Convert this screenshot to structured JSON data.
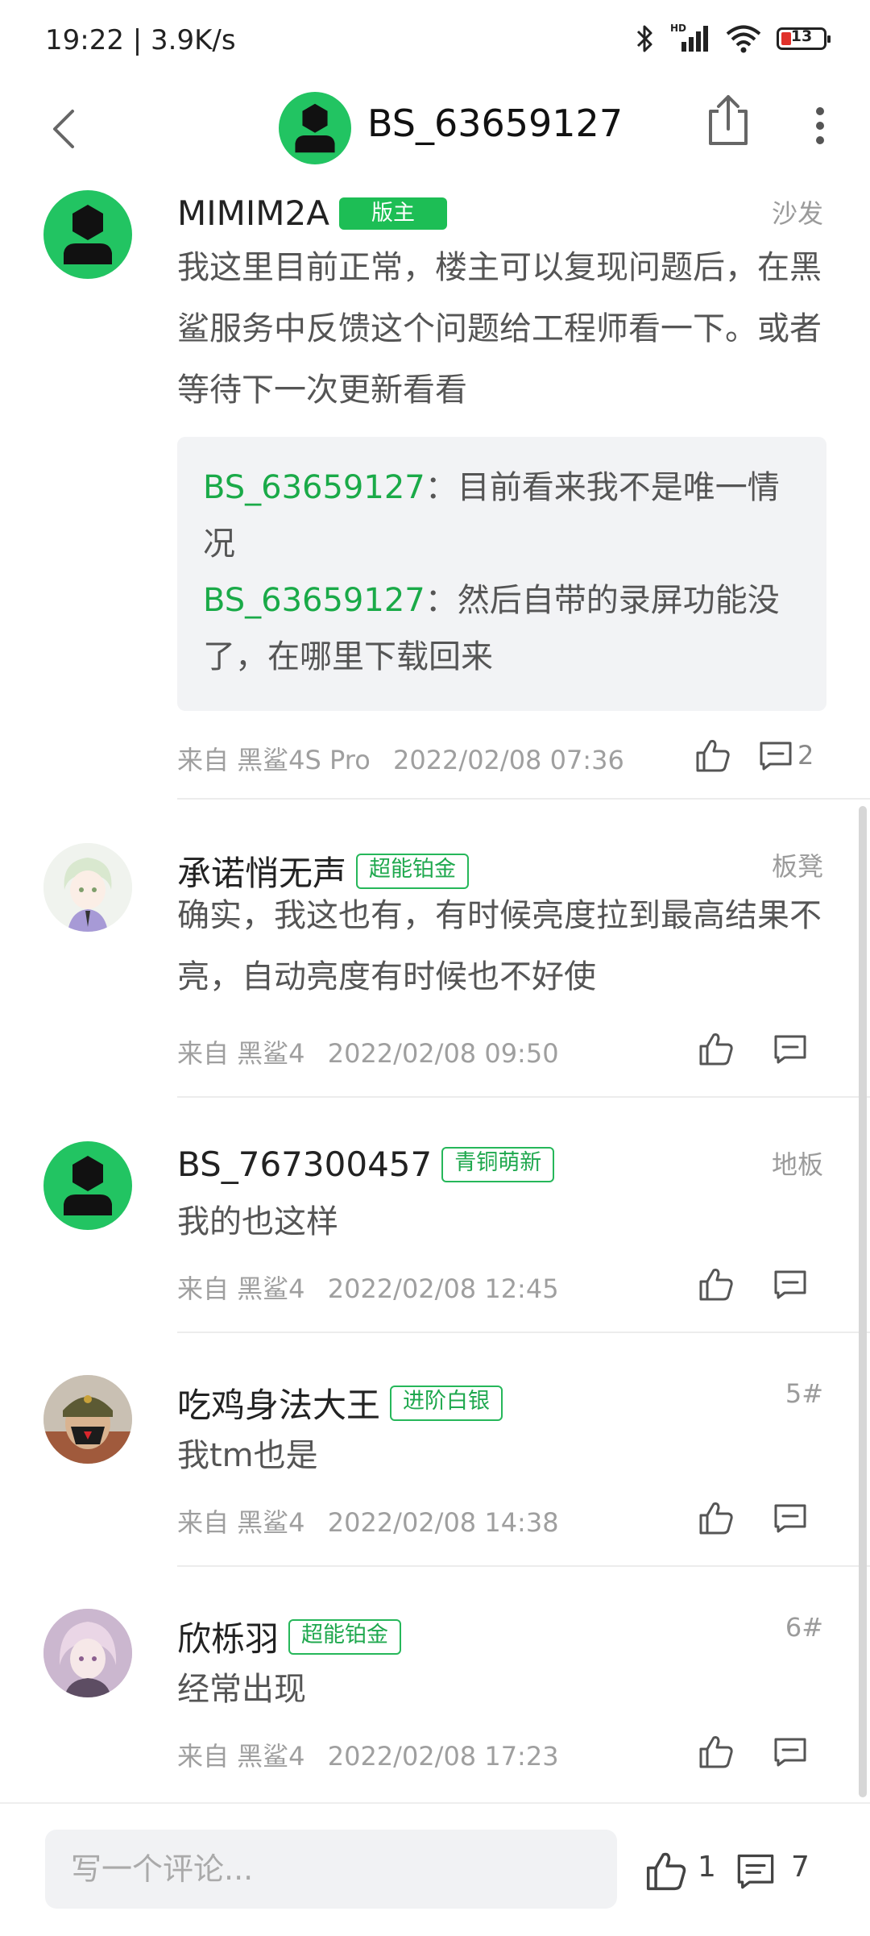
{
  "status_bar": {
    "time": "19:22 | 3.9K/s",
    "battery": "13",
    "network": "HD"
  },
  "header": {
    "title": "BS_63659127"
  },
  "posts": [
    {
      "username": "MIMIM2A",
      "badge": "版主",
      "floor": "沙发",
      "content": "我这里目前正常，楼主可以复现问题后，在黑鲨服务中反馈这个问题给工程师看一下。或者等待下一次更新看看",
      "quotes": [
        {
          "user": "BS_63659127",
          "sep": "：",
          "text": "目前看来我不是唯一情况"
        },
        {
          "user": "BS_63659127",
          "sep": "：",
          "text": "然后自带的录屏功能没了，在哪里下载回来"
        }
      ],
      "device": "来自 黑鲨4S Pro",
      "time": "2022/02/08 07:36",
      "reply_count": "2"
    },
    {
      "username": "承诺悄无声",
      "badge": "超能铂金",
      "floor": "板凳",
      "content": "确实，我这也有，有时候亮度拉到最高结果不亮，自动亮度有时候也不好使",
      "device": "来自 黑鲨4",
      "time": "2022/02/08 09:50"
    },
    {
      "username": "BS_767300457",
      "badge": "青铜萌新",
      "floor": "地板",
      "content": "我的也这样",
      "device": "来自 黑鲨4",
      "time": "2022/02/08 12:45"
    },
    {
      "username": "吃鸡身法大王",
      "badge": "进阶白银",
      "floor": "5#",
      "content": "我tm也是",
      "device": "来自 黑鲨4",
      "time": "2022/02/08 14:38"
    },
    {
      "username": "欣栎羽",
      "badge": "超能铂金",
      "floor": "6#",
      "content": "经常出现",
      "device": "来自 黑鲨4",
      "time": "2022/02/08 17:23"
    }
  ],
  "bottom_bar": {
    "comment_placeholder": "写一个评论...",
    "like_count": "1",
    "comment_count": "7"
  },
  "colors": {
    "accent": "#1dbe55",
    "avatar_green": "#22c462"
  }
}
